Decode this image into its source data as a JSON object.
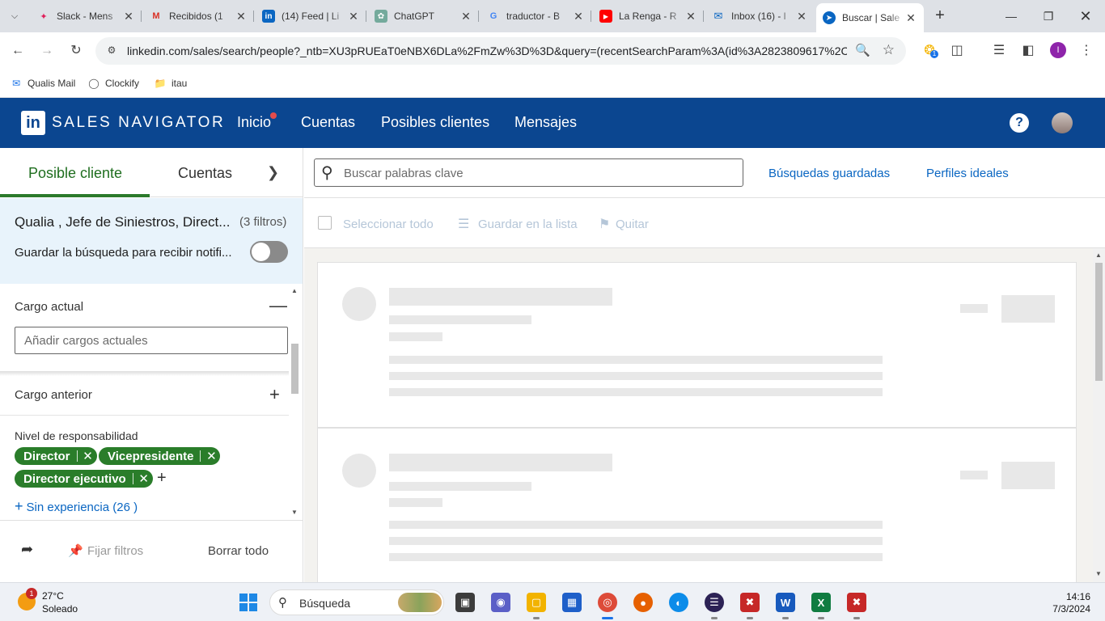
{
  "browser": {
    "tabs": [
      {
        "title": "Slack - Mens",
        "icon": "slack-icon"
      },
      {
        "title": "Recibidos (1",
        "icon": "gmail-icon"
      },
      {
        "title": "(14) Feed | Li",
        "icon": "linkedin-icon"
      },
      {
        "title": "ChatGPT",
        "icon": "chatgpt-icon"
      },
      {
        "title": "traductor - B",
        "icon": "google-icon"
      },
      {
        "title": "La Renga - R",
        "icon": "youtube-icon"
      },
      {
        "title": "Inbox (16) - l",
        "icon": "mail-icon"
      },
      {
        "title": "Buscar | Sale",
        "icon": "compass-icon",
        "active": true
      }
    ],
    "url": "linkedin.com/sales/search/people?_ntb=XU3pRUEaT0eNBX6DLa%2FmZw%3D%3D&query=(recentSearchParam%3A(id%3A2823809617%2Cdo...",
    "extension_badge": "1",
    "profile_initial": "I",
    "bookmarks": [
      {
        "label": "Qualis Mail",
        "icon": "mail-icon"
      },
      {
        "label": "Clockify",
        "icon": "clockify-icon"
      },
      {
        "label": "itau",
        "icon": "folder-icon"
      }
    ]
  },
  "salesnav": {
    "logo": "in",
    "brand": "SALES NAVIGATOR",
    "nav": [
      "Inicio",
      "Cuentas",
      "Posibles clientes",
      "Mensajes"
    ],
    "help": "?"
  },
  "left": {
    "tabs": [
      "Posible cliente",
      "Cuentas"
    ],
    "saved_search_title": "Qualia , Jefe de Siniestros, Direct...",
    "filters_count": "(3 filtros)",
    "notify_label": "Guardar la búsqueda para recibir notifi...",
    "cargo_actual_label": "Cargo actual",
    "cargo_actual_placeholder": "Añadir cargos actuales",
    "cargo_anterior_label": "Cargo anterior",
    "nivel_label": "Nivel de responsabilidad",
    "pills": [
      "Director",
      "Vicepresidente",
      "Director ejecutivo"
    ],
    "sin_experiencia": "Sin experiencia (26 )",
    "footer": {
      "pin": "Fijar filtros",
      "clear": "Borrar todo"
    }
  },
  "right": {
    "search_placeholder": "Buscar palabras clave",
    "saved_searches": "Búsquedas guardadas",
    "ideal_profiles": "Perfiles ideales",
    "select_all": "Seleccionar todo",
    "save_to_list": "Guardar en la lista",
    "remove": "Quitar"
  },
  "taskbar": {
    "weather_badge": "1",
    "temperature": "27°C",
    "condition": "Soleado",
    "search_label": "Búsqueda",
    "time": "14:16",
    "date": "7/3/2024"
  },
  "colors": {
    "salesnav_header": "#0b4690",
    "accent_green": "#2a7d2a",
    "link_blue": "#0a66c2",
    "saved_search_bg": "#e8f3fb"
  }
}
